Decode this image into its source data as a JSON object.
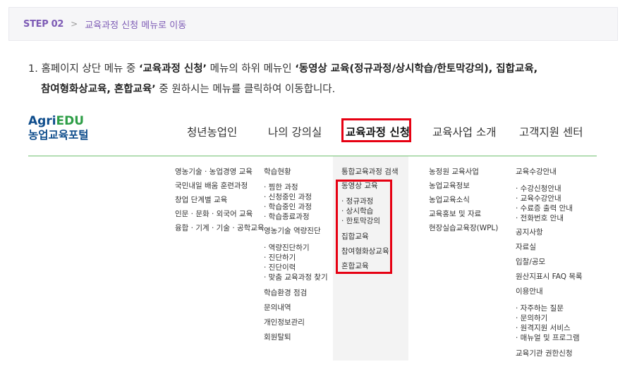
{
  "step": {
    "label": "STEP 02",
    "chevron": ">",
    "title": "교육과정 신청 메뉴로 이동"
  },
  "instruction": {
    "num": "1.",
    "t1": " 홈페이지 상단 메뉴 중 ",
    "b1": "‘교육과정 신청’",
    "t2": " 메뉴의 하위 메뉴인 ",
    "b2": "‘동영상 교육(정규과정/상시학습/한토막강의), 집합교육,",
    "b3": "참여형화상교육, 혼합교육’",
    "t3": " 중 원하시는 메뉴를 클릭하여 이동합니다."
  },
  "logo": {
    "agri": "Agri",
    "edu": "EDU",
    "kor": "농업교육포털"
  },
  "gnb": [
    "청년농업인",
    "나의 강의실",
    "교육과정 신청",
    "교육사업 소개",
    "고객지원 센터"
  ],
  "menus": {
    "col1": [
      "영농기술 · 농업경영 교육",
      "국민내일 배움 훈련과정",
      "창업 단계별 교육",
      "인문 · 문화 · 외국어 교육",
      "융합 · 기계 · 기술 · 공학교육"
    ],
    "col2": {
      "h1": "학습현황",
      "s1": [
        "· 찜한 과정",
        "· 신청중인 과정",
        "· 학습중인 과정",
        "· 학습종료과정"
      ],
      "h2": "영농기술 역량진단",
      "s2": [
        "· 역량진단하기",
        "· 진단하기",
        "· 진단이력",
        "· 맞춤 교육과정 찾기"
      ],
      "rest": [
        "학습환경 점검",
        "문의내역",
        "개인정보관리",
        "회원탈퇴"
      ]
    },
    "col3": {
      "search": "통합교육과정 검색",
      "video": "동영상 교육",
      "subs": [
        "· 정규과정",
        "· 상시학습",
        "· 한토막강의"
      ],
      "rest": [
        "집합교육",
        "참여형화상교육",
        "혼합교육"
      ]
    },
    "col4": [
      "농정원 교육사업",
      "농업교육정보",
      "농업교육소식",
      "교육홍보 및 자료",
      "현장실습교육장(WPL)"
    ],
    "col5": {
      "h1": "교육수강안내",
      "s1": [
        "· 수강신청안내",
        "· 교육수강안내",
        "· 수료증 출력 안내",
        "· 전화번호 안내"
      ],
      "mid": [
        "공지사항",
        "자료실",
        "입찰/공모",
        "원산지표시 FAQ 목록",
        "이용안내"
      ],
      "s2": [
        "· 자주하는 질문",
        "· 문의하기",
        "· 원격지원 서비스",
        "· 매뉴얼 및 프로그램"
      ],
      "last": "교육기관 권한신청"
    }
  }
}
